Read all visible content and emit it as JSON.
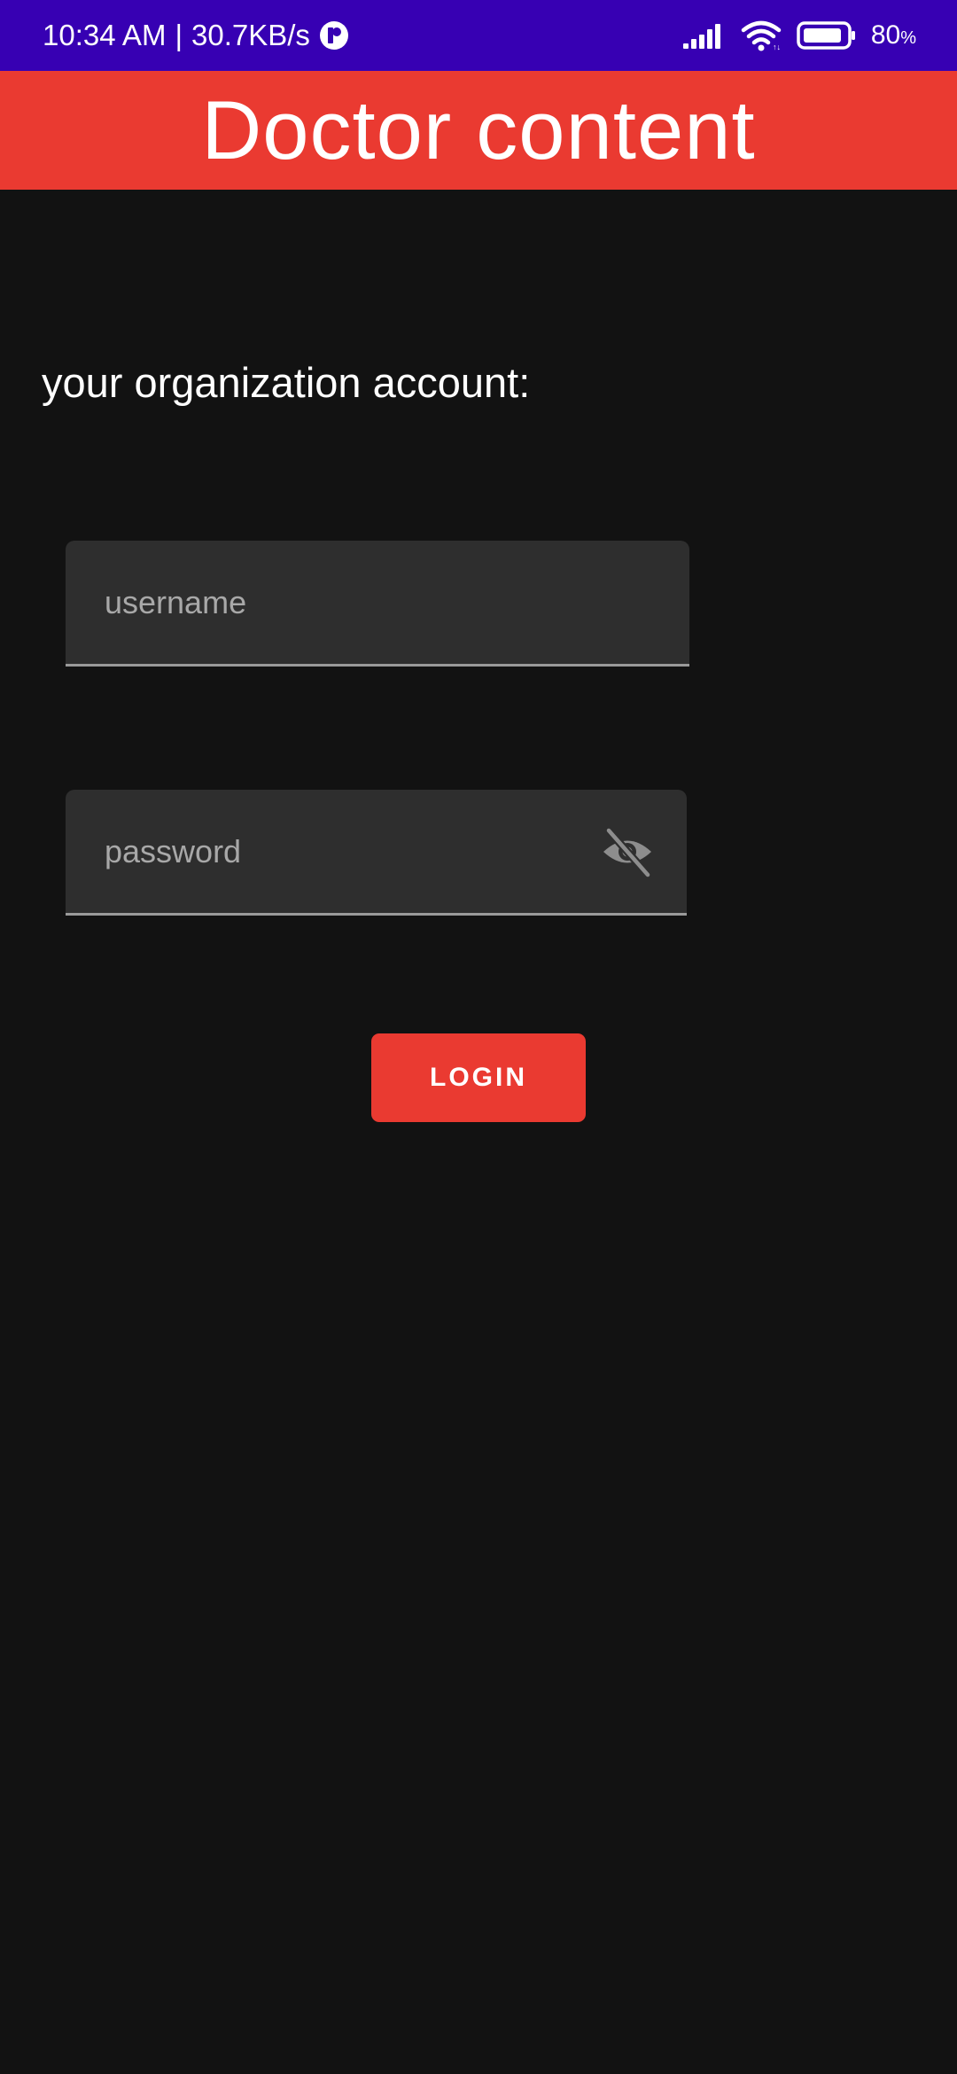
{
  "status_bar": {
    "time": "10:34 AM",
    "separator": "|",
    "network_speed": "30.7KB/s",
    "battery_level": "80",
    "battery_unit": "%",
    "icons": [
      "app-notification-icon",
      "signal-icon",
      "wifi-icon",
      "battery-icon"
    ]
  },
  "app_bar": {
    "title": "Doctor content"
  },
  "login_form": {
    "prompt": "your organization account:",
    "username_placeholder": "username",
    "username_value": "",
    "password_placeholder": "password",
    "password_value": "",
    "visibility_icon": "eye-off-icon",
    "login_label": "LOGIN"
  },
  "colors": {
    "status_bar_bg": "#3700b3",
    "app_bar_bg": "#ea3a31",
    "page_bg": "#121212",
    "field_bg": "#2e2e2e",
    "button_bg": "#ea3a31",
    "text_primary": "#ffffff",
    "placeholder_text": "#a8a8a8"
  }
}
